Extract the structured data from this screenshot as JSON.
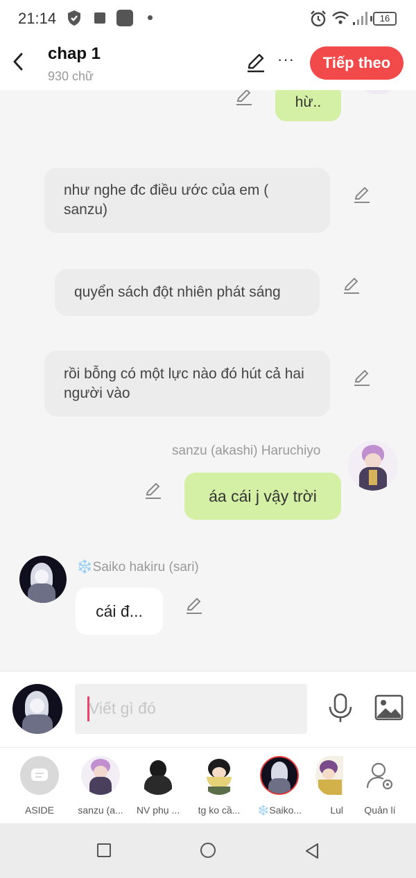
{
  "status_bar": {
    "time": "21:14",
    "battery": "16"
  },
  "header": {
    "title": "chap 1",
    "word_count": "930 chữ",
    "next_button": "Tiếp theo",
    "more_label": "···"
  },
  "messages": [
    {
      "id": "m0",
      "type": "own",
      "text": "hừ.."
    },
    {
      "id": "m1",
      "type": "narration",
      "text": "như nghe đc điều ước của em ( sanzu)"
    },
    {
      "id": "m2",
      "type": "narration",
      "text": "quyển sách đột nhiên phát sáng"
    },
    {
      "id": "m3",
      "type": "narration",
      "text": "rồi bỗng có một lực nào đó hút cả hai người vào"
    },
    {
      "id": "m4",
      "type": "own",
      "sender": "sanzu (akashi) Haruchiyo",
      "text": "áa cái j vậy trời"
    },
    {
      "id": "m5",
      "type": "other",
      "sender": "❄️Saiko hakiru (sari)",
      "text": "cái đ..."
    }
  ],
  "input": {
    "placeholder": "Viết gì đó"
  },
  "characters": [
    {
      "name": "ASIDE"
    },
    {
      "name": "sanzu (a..."
    },
    {
      "name": "NV phụ ..."
    },
    {
      "name": "tg ko cầ..."
    },
    {
      "name": "❄️Saiko..."
    },
    {
      "name": "Lul"
    },
    {
      "name": "Quản lí"
    }
  ],
  "colors": {
    "accent": "#f24a4a",
    "own_bubble": "#d4f0a4",
    "narration_bubble": "#ececec"
  }
}
